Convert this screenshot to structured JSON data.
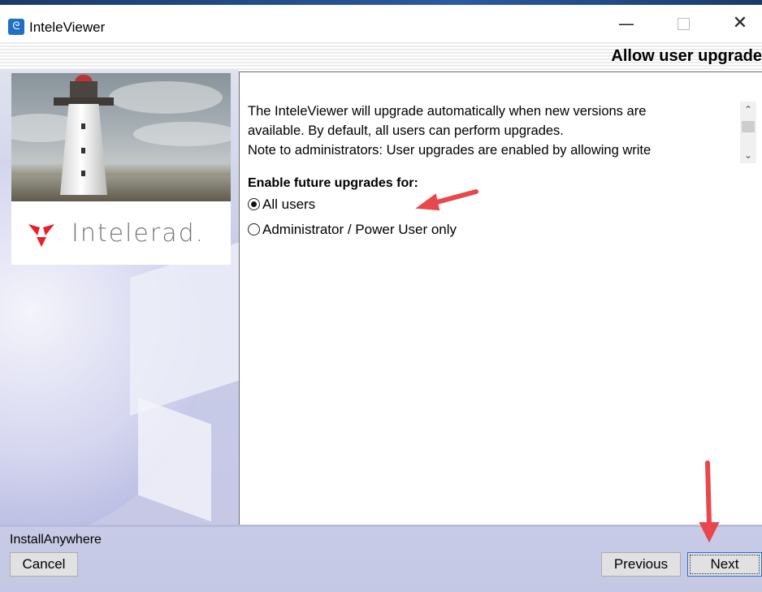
{
  "window": {
    "title": "InteleViewer",
    "icon": "inteleviewer-app-icon",
    "controls": {
      "minimize": "—",
      "maximize": "",
      "close": "✕"
    }
  },
  "header": {
    "title": "Allow user upgrade"
  },
  "branding": {
    "logo_text": "Intelerad.",
    "photo": "lighthouse-photo",
    "logo_color": "#e8202a"
  },
  "content": {
    "intro_lines": [
      "The InteleViewer will upgrade automatically when new versions are",
      "available. By default, all users can perform upgrades.",
      "Note to administrators: User upgrades are enabled by allowing write"
    ],
    "section_label": "Enable future upgrades for:",
    "options": [
      {
        "label": "All users",
        "selected": true
      },
      {
        "label": "Administrator / Power User only",
        "selected": false
      }
    ]
  },
  "footer": {
    "installer_label": "InstallAnywhere",
    "cancel_label": "Cancel",
    "previous_label": "Previous",
    "next_label": "Next"
  },
  "colors": {
    "accent": "#2a6fd1",
    "annotation_arrow": "#e8474b",
    "sidebar": "#c6c8e6"
  }
}
